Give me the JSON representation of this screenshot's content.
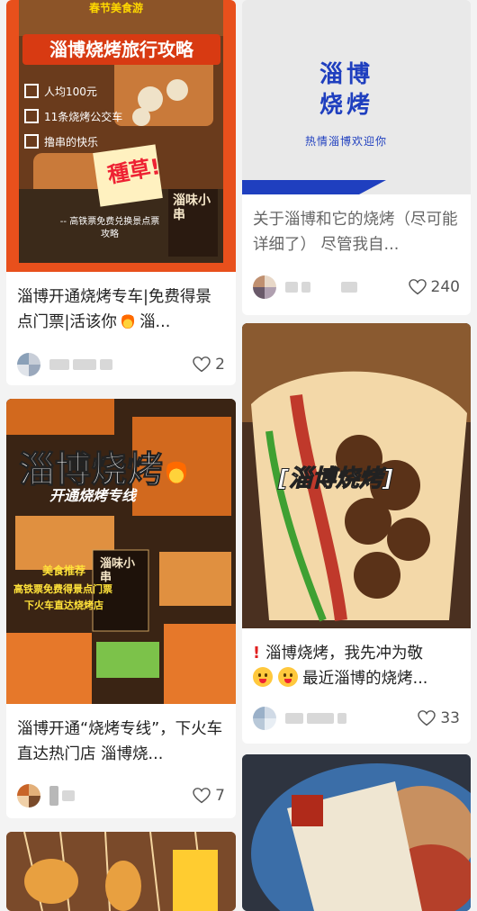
{
  "cards": {
    "c1": {
      "image_text": {
        "banner": "淄博烧烤旅行攻略",
        "top_strip": "春节美食游",
        "check1": "人均100元",
        "check2": "11条烧烤公交车",
        "check3": "撸串的快乐",
        "stamp": "種草!",
        "bottom": "-- 高铁票免费兑换景点票\n攻略",
        "shop_sign": "淄味小串"
      },
      "title": "淄博开通烧烤专车|免费得景点门票|活该你",
      "title_tail": "淄...",
      "likes": "2"
    },
    "c2": {
      "image_text": {
        "logo_line1": "淄博",
        "logo_line2": "烧烤",
        "tagline": "热情淄博欢迎你"
      },
      "title": "关于淄博和它的烧烤（尽可能详细了） 尽管我自...",
      "likes": "240"
    },
    "c3": {
      "image_text": {
        "label": "[淄博烧烤]"
      },
      "title_a": "淄博烧烤，我先冲为敬",
      "title_b": "最近淄博的烧烤...",
      "likes": "33"
    },
    "c4": {
      "image_text": {
        "headline": "淄博烧烤",
        "subline": "开通烧烤专线",
        "tag": "美食推荐",
        "line1": "高铁票免费得景点门票",
        "line2": "下火车直达烧烤店",
        "shop_sign": "淄味小串"
      },
      "title": "淄博开通“烧烤专线”，下火车直达热门店 淄博烧...",
      "likes": "7"
    }
  },
  "colors": {
    "accent_orange": "#e8501c",
    "brand_blue": "#1f3fbf",
    "heart_gray": "#555555"
  },
  "icons": [
    "heart-icon",
    "fire-emoji-icon",
    "grinning-emoji-icon",
    "exclamation-icon",
    "check-box-icon"
  ]
}
